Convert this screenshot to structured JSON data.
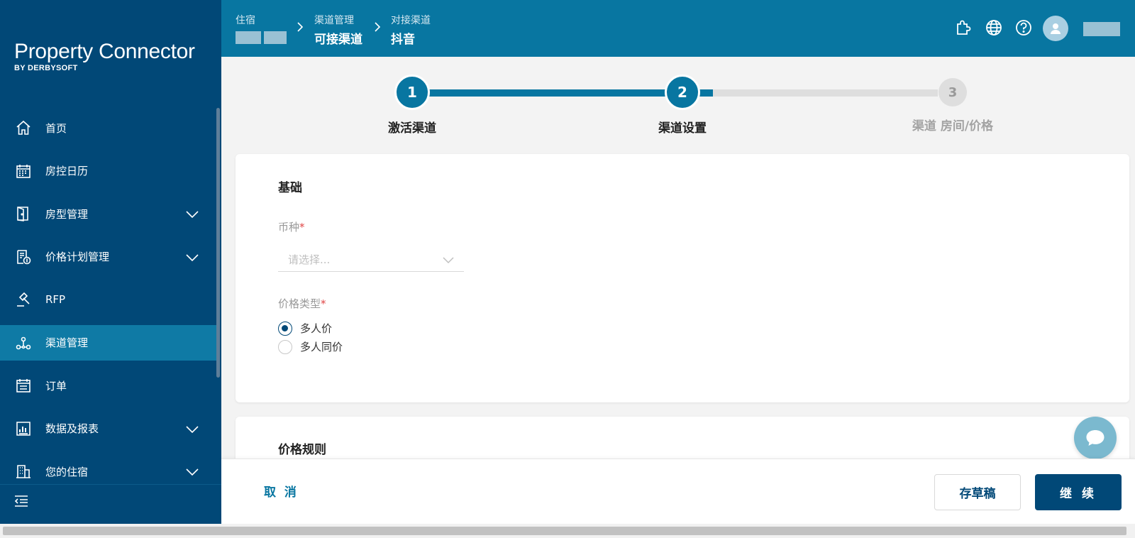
{
  "app": {
    "logo_main": "Property Connector",
    "logo_sub": "BY DERBYSOFT"
  },
  "sidebar": {
    "items": [
      {
        "label": "首页",
        "icon": "home-icon",
        "expandable": false,
        "active": false
      },
      {
        "label": "房控日历",
        "icon": "calendar-icon",
        "expandable": false,
        "active": false
      },
      {
        "label": "房型管理",
        "icon": "door-icon",
        "expandable": true,
        "active": false
      },
      {
        "label": "价格计划管理",
        "icon": "price-plan-icon",
        "expandable": true,
        "active": false
      },
      {
        "label": "RFP",
        "icon": "gavel-icon",
        "expandable": false,
        "active": false
      },
      {
        "label": "渠道管理",
        "icon": "channel-icon",
        "expandable": false,
        "active": true
      },
      {
        "label": "订单",
        "icon": "order-icon",
        "expandable": false,
        "active": false
      },
      {
        "label": "数据及报表",
        "icon": "report-icon",
        "expandable": true,
        "active": false
      },
      {
        "label": "您的住宿",
        "icon": "building-icon",
        "expandable": true,
        "active": false
      }
    ]
  },
  "header": {
    "breadcrumbs": [
      {
        "top": "住宿",
        "bottom": ""
      },
      {
        "top": "渠道管理",
        "bottom": "可接渠道"
      },
      {
        "top": "对接渠道",
        "bottom": "抖音"
      }
    ]
  },
  "stepper": {
    "steps": [
      {
        "number": "1",
        "label": "激活渠道",
        "state": "done"
      },
      {
        "number": "2",
        "label": "渠道设置",
        "state": "current"
      },
      {
        "number": "3",
        "label": "渠道 房间/价格",
        "state": "todo"
      }
    ],
    "progress": 0.56
  },
  "basic_card": {
    "title": "基础",
    "currency_label": "币种",
    "currency_placeholder": "请选择...",
    "price_type_label": "价格类型",
    "required_mark": "*",
    "price_type_options": [
      {
        "label": "多人价",
        "checked": true
      },
      {
        "label": "多人同价",
        "checked": false
      }
    ]
  },
  "price_rules_card": {
    "title": "价格规则"
  },
  "footer": {
    "cancel_label": "取 消",
    "draft_label": "存草稿",
    "continue_label": "继 续"
  },
  "colors": {
    "sidebar_bg": "#014877",
    "header_bg": "#0876a1",
    "active_nav": "#0f7aa5",
    "primary_button": "#014877",
    "required": "#e04646"
  }
}
